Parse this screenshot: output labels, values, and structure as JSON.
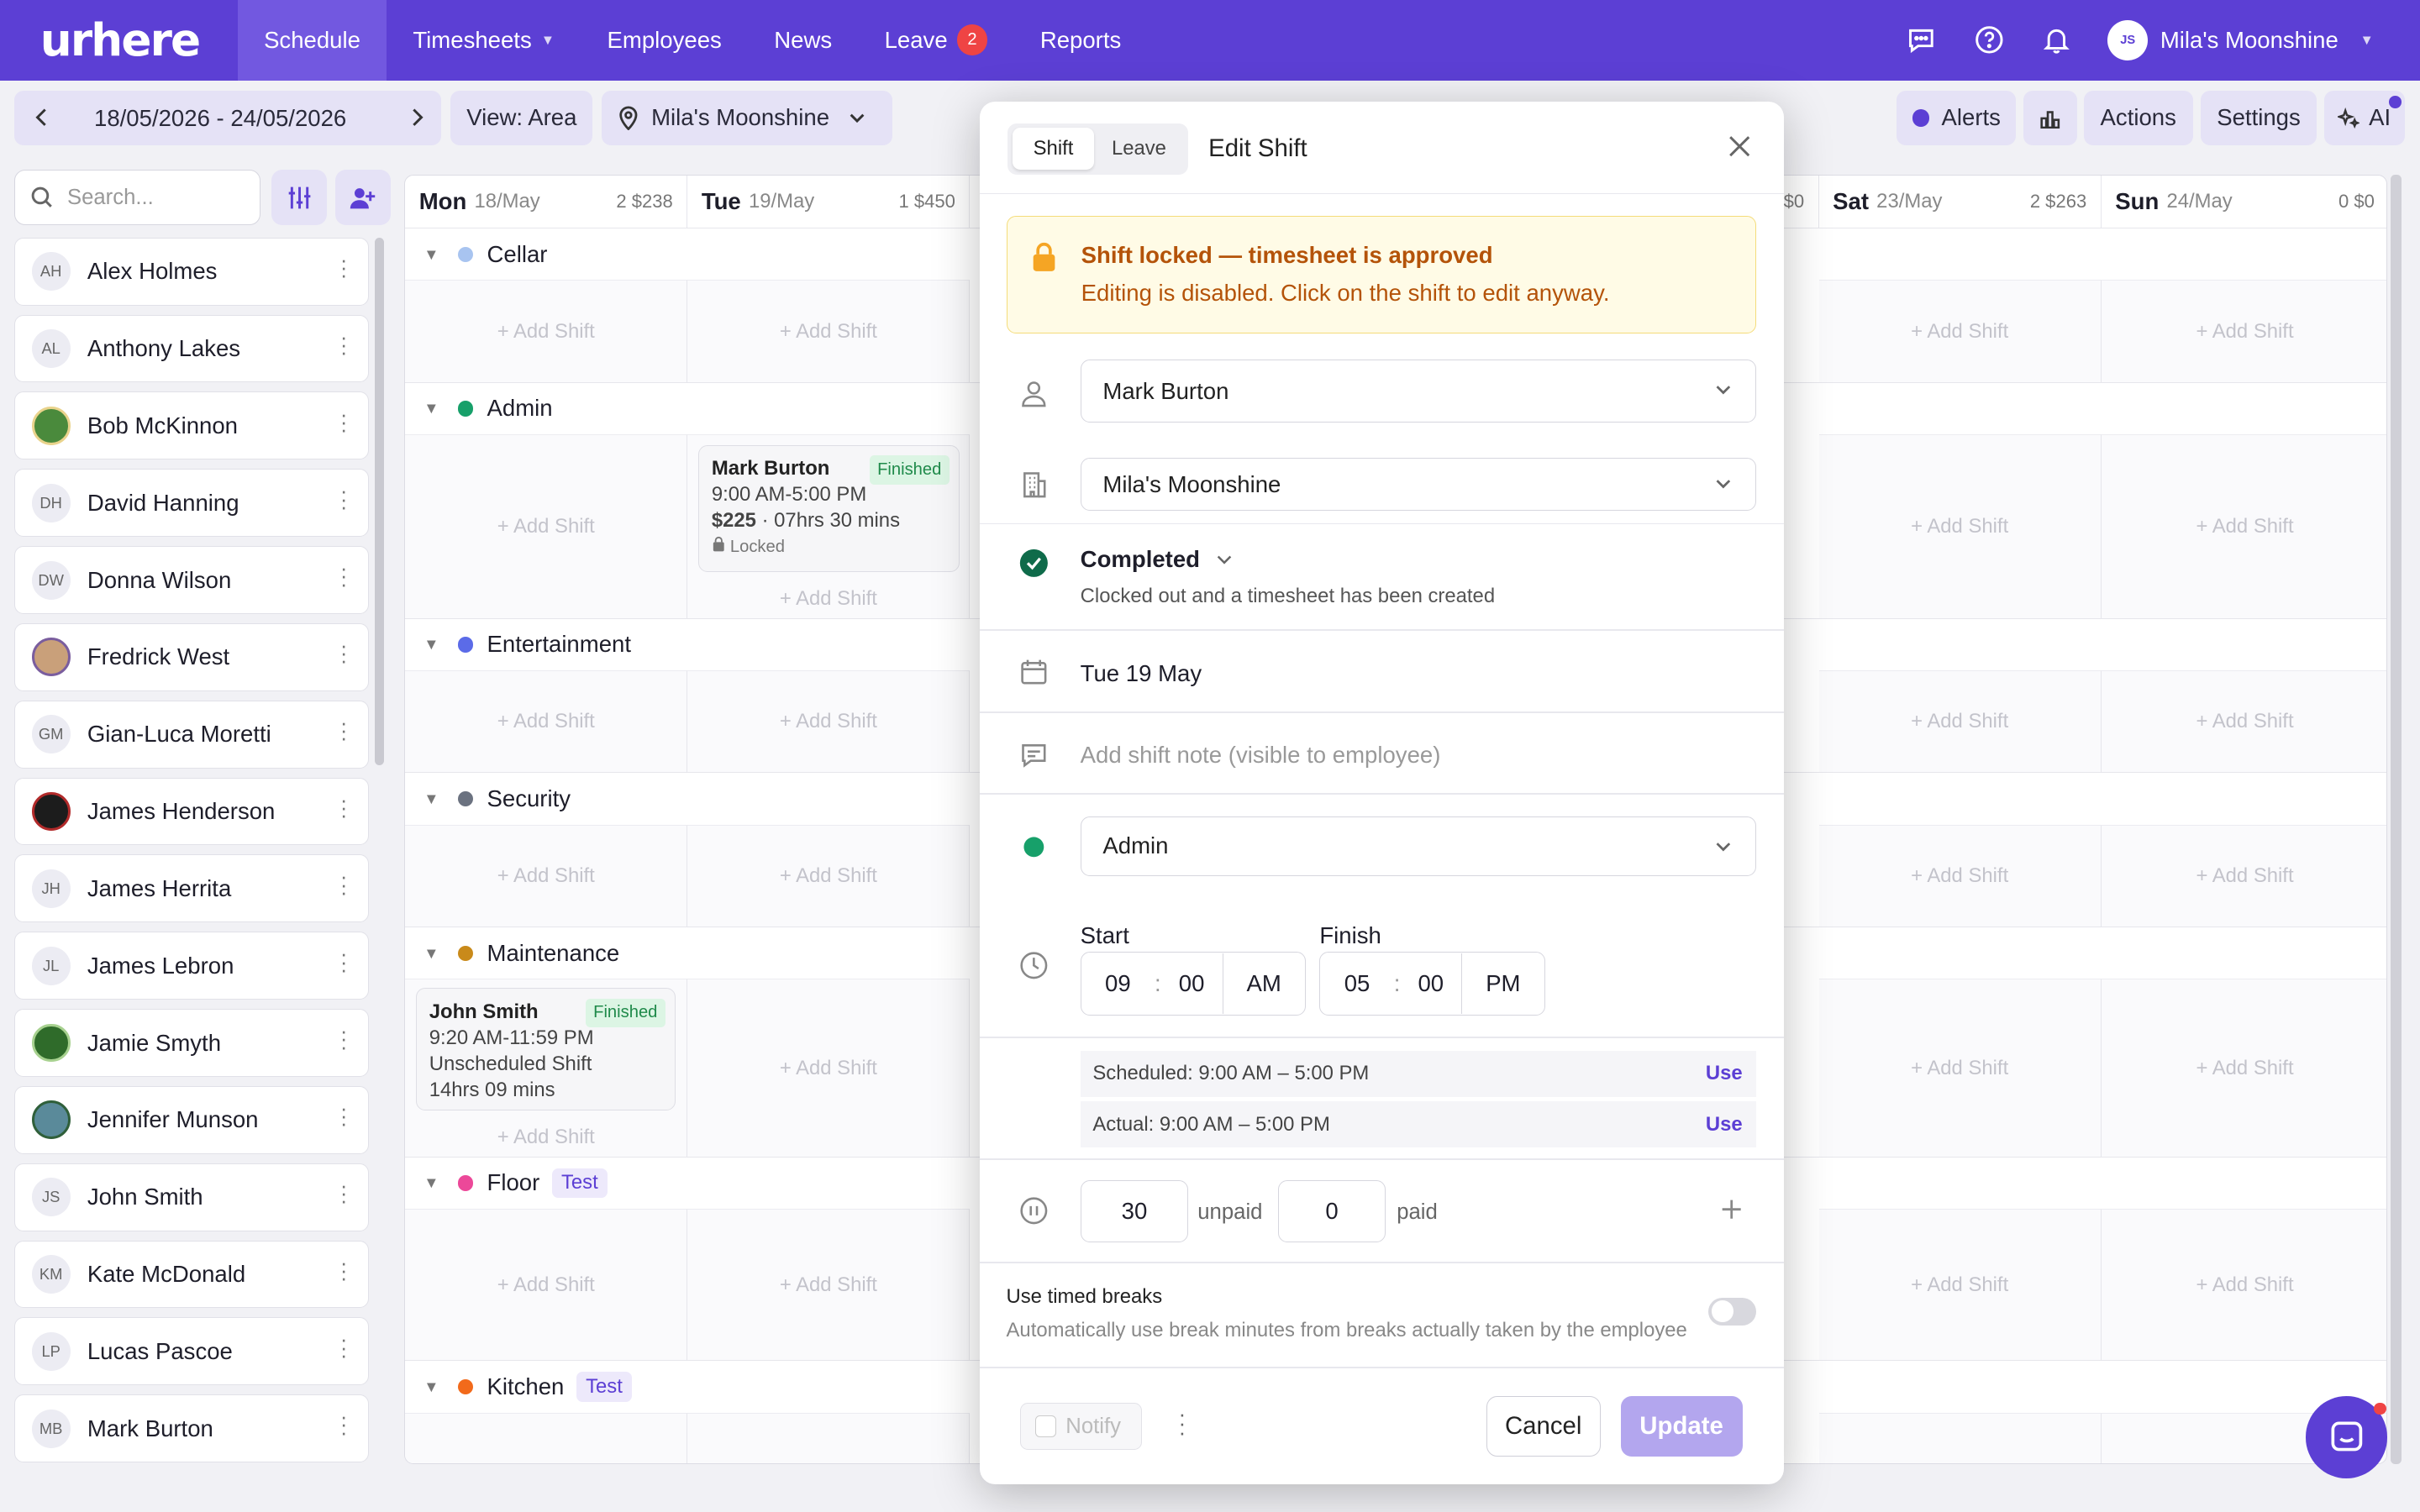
{
  "app": {
    "logo": "urhere"
  },
  "nav": [
    {
      "label": "Schedule"
    },
    {
      "label": "Timesheets"
    },
    {
      "label": "Employees"
    },
    {
      "label": "News"
    },
    {
      "label": "Leave",
      "badge": "2"
    },
    {
      "label": "Reports"
    }
  ],
  "user": {
    "initials": "JS",
    "name": "Mila's Moonshine"
  },
  "toolbar": {
    "date_range": "18/05/2026 - 24/05/2026",
    "view": "View: Area",
    "location": "Mila's Moonshine",
    "alerts": "Alerts",
    "actions": "Actions",
    "settings": "Settings",
    "ai": "AI"
  },
  "sidebar": {
    "search_placeholder": "Search...",
    "employees": [
      {
        "initials": "AH",
        "name": "Alex Holmes"
      },
      {
        "initials": "AL",
        "name": "Anthony Lakes"
      },
      {
        "initials": "",
        "name": "Bob McKinnon",
        "photo": true
      },
      {
        "initials": "DH",
        "name": "David Hanning"
      },
      {
        "initials": "DW",
        "name": "Donna Wilson"
      },
      {
        "initials": "",
        "name": "Fredrick West",
        "photo": true
      },
      {
        "initials": "GM",
        "name": "Gian-Luca Moretti"
      },
      {
        "initials": "",
        "name": "James Henderson",
        "photo": true
      },
      {
        "initials": "JH",
        "name": "James Herrita"
      },
      {
        "initials": "JL",
        "name": "James Lebron"
      },
      {
        "initials": "",
        "name": "Jamie Smyth",
        "photo": true
      },
      {
        "initials": "",
        "name": "Jennifer Munson",
        "photo": true
      },
      {
        "initials": "JS",
        "name": "John Smith"
      },
      {
        "initials": "KM",
        "name": "Kate McDonald"
      },
      {
        "initials": "LP",
        "name": "Lucas Pascoe"
      },
      {
        "initials": "MB",
        "name": "Mark Burton"
      }
    ]
  },
  "days": [
    {
      "name": "Mon",
      "date": "18/May",
      "stat": "2 $238"
    },
    {
      "name": "Tue",
      "date": "19/May",
      "stat": "1 $450"
    },
    {
      "name": "",
      "date": "",
      "stat": "$0"
    },
    {
      "name": "Sat",
      "date": "23/May",
      "stat": "2 $263"
    },
    {
      "name": "Sun",
      "date": "24/May",
      "stat": "0 $0"
    }
  ],
  "add_shift": "+ Add Shift",
  "sections": [
    {
      "name": "Cellar",
      "color": "#a8c4f0"
    },
    {
      "name": "Admin",
      "color": "#17a06a"
    },
    {
      "name": "Entertainment",
      "color": "#5b6be8"
    },
    {
      "name": "Security",
      "color": "#6b7280"
    },
    {
      "name": "Maintenance",
      "color": "#c98a1a"
    },
    {
      "name": "Floor",
      "color": "#ec4899",
      "tag": "Test"
    },
    {
      "name": "Kitchen",
      "color": "#f26a1b",
      "tag": "Test"
    }
  ],
  "shifts": {
    "admin_tue": {
      "name": "Mark Burton",
      "status": "Finished",
      "time": "9:00 AM-5:00 PM",
      "cost": "$225",
      "duration": "07hrs 30 mins",
      "lock": "Locked"
    },
    "maint_mon": {
      "name": "John Smith",
      "status": "Finished",
      "time": "9:20 AM-11:59 PM",
      "note": "Unscheduled Shift",
      "duration": "14hrs 09 mins"
    }
  },
  "modal": {
    "tabs": [
      "Shift",
      "Leave"
    ],
    "title": "Edit Shift",
    "warning_title": "Shift locked — timesheet is approved",
    "warning_text": "Editing is disabled. Click on the shift to edit anyway.",
    "employee": "Mark Burton",
    "location": "Mila's Moonshine",
    "status": "Completed",
    "status_sub": "Clocked out and a timesheet has been created",
    "date": "Tue 19 May",
    "note_placeholder": "Add shift note (visible to employee)",
    "area": "Admin",
    "start_label": "Start",
    "finish_label": "Finish",
    "start": {
      "h": "09",
      "m": "00",
      "ampm": "AM"
    },
    "finish": {
      "h": "05",
      "m": "00",
      "ampm": "PM"
    },
    "scheduled": "Scheduled: 9:00 AM – 5:00 PM",
    "actual": "Actual: 9:00 AM – 5:00 PM",
    "use": "Use",
    "unpaid_value": "30",
    "unpaid_label": "unpaid",
    "paid_value": "0",
    "paid_label": "paid",
    "timed_breaks_title": "Use timed breaks",
    "timed_breaks_desc": "Automatically use break minutes from breaks actually taken by the employee",
    "notify": "Notify",
    "cancel": "Cancel",
    "update": "Update"
  },
  "colors": {
    "brand": "#5c3fd4",
    "warning_bg": "#fffbe6",
    "warning_text": "#b45309",
    "success": "#17a06a"
  }
}
